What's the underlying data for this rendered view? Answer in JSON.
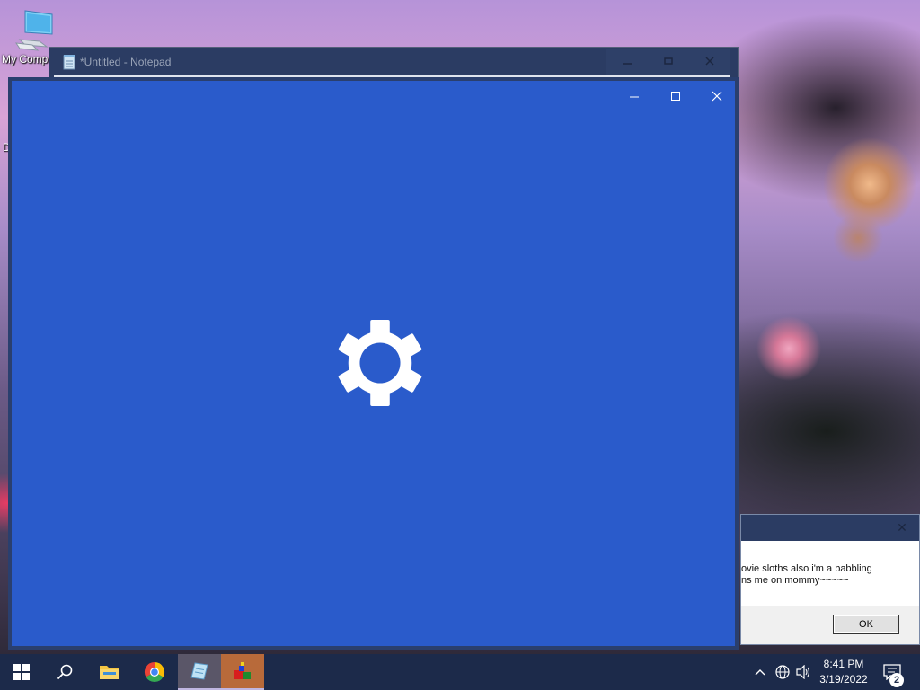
{
  "desktop": {
    "icon_label": "My Comp",
    "partial_letter": "D"
  },
  "notepad": {
    "title": "*Untitled - Notepad"
  },
  "settings_window": {
    "icon": "gear-icon",
    "background_color": "#2a5bcb"
  },
  "message_box": {
    "line1": "ovie sloths also i'm a babbling",
    "line2": "ns me on mommy~~~~~",
    "ok_label": "OK",
    "close_glyph": "✕"
  },
  "taskbar": {
    "items": [
      "start-icon",
      "search-icon",
      "file-explorer-icon",
      "chrome-icon",
      "notepad-icon",
      "app-icon"
    ],
    "time": "8:41 PM",
    "date": "3/19/2022",
    "notification_count": "2"
  },
  "colors": {
    "taskbar": "#1c2a4a",
    "accent": "#2a5bcb"
  }
}
